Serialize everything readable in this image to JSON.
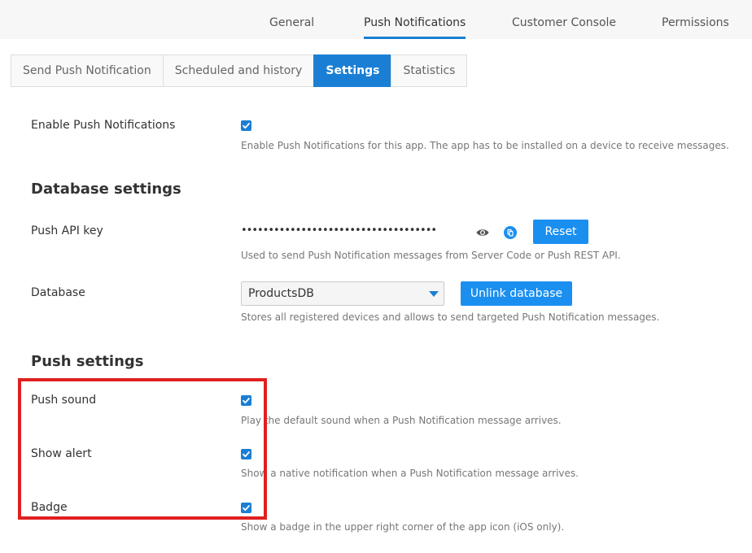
{
  "top_tabs": [
    {
      "label": "General",
      "active": false
    },
    {
      "label": "Push Notifications",
      "active": true
    },
    {
      "label": "Customer Console",
      "active": false
    },
    {
      "label": "Permissions",
      "active": false
    }
  ],
  "sub_tabs": [
    {
      "label": "Send Push Notification",
      "active": false
    },
    {
      "label": "Scheduled and history",
      "active": false
    },
    {
      "label": "Settings",
      "active": true
    },
    {
      "label": "Statistics",
      "active": false
    }
  ],
  "enable": {
    "label": "Enable Push Notifications",
    "checked": true,
    "hint": "Enable Push Notifications for this app. The app has to be installed on a device to receive messages."
  },
  "database_settings": {
    "title": "Database settings",
    "api_key": {
      "label": "Push API key",
      "value": "••••••••••••••••••••••••••••••••••••",
      "reset_label": "Reset",
      "hint": "Used to send Push Notification messages from Server Code or Push REST API.",
      "show_icon": "eye-icon",
      "copy_icon": "copy-icon"
    },
    "database": {
      "label": "Database",
      "selected": "ProductsDB",
      "unlink_label": "Unlink database",
      "hint": "Stores all registered devices and allows to send targeted Push Notification messages."
    }
  },
  "push_settings": {
    "title": "Push settings",
    "sound": {
      "label": "Push sound",
      "checked": true,
      "hint": "Play the default sound when a Push Notification message arrives."
    },
    "alert": {
      "label": "Show alert",
      "checked": true,
      "hint": "Show a native notification when a Push Notification message arrives."
    },
    "badge": {
      "label": "Badge",
      "checked": true,
      "hint": "Show a badge in the upper right corner of the app icon (iOS only)."
    }
  },
  "colors": {
    "accent": "#1a7fd4",
    "button": "#1a8ff0",
    "highlight": "#e02020"
  }
}
